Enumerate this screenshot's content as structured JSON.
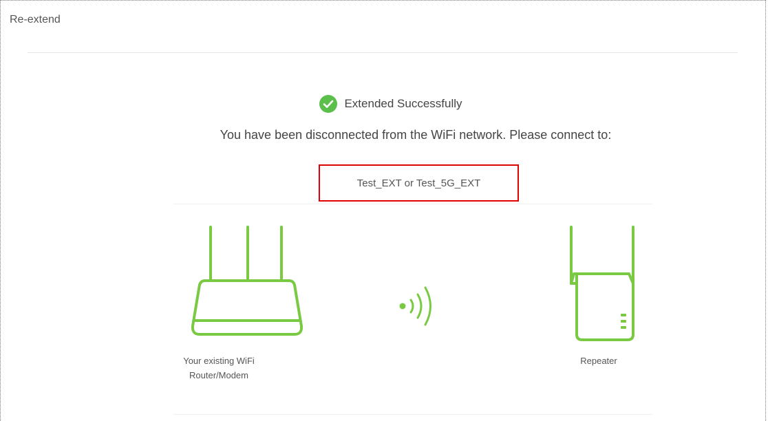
{
  "header": {
    "title": "Re-extend"
  },
  "status": {
    "success_text": "Extended Successfully",
    "message": "You have been disconnected from the WiFi network. Please connect to:",
    "ssid_text": "Test_EXT or Test_5G_EXT",
    "highlight_color": "#e00000"
  },
  "devices": {
    "router_label_line1": "Your existing WiFi",
    "router_label_line2": "Router/Modem",
    "repeater_label": "Repeater"
  },
  "colors": {
    "accent_green": "#7ac943",
    "success_green": "#5cbf4c"
  },
  "icons": {
    "success": "check-circle-icon",
    "router": "router-icon",
    "signal": "wifi-signal-icon",
    "repeater": "repeater-icon"
  }
}
